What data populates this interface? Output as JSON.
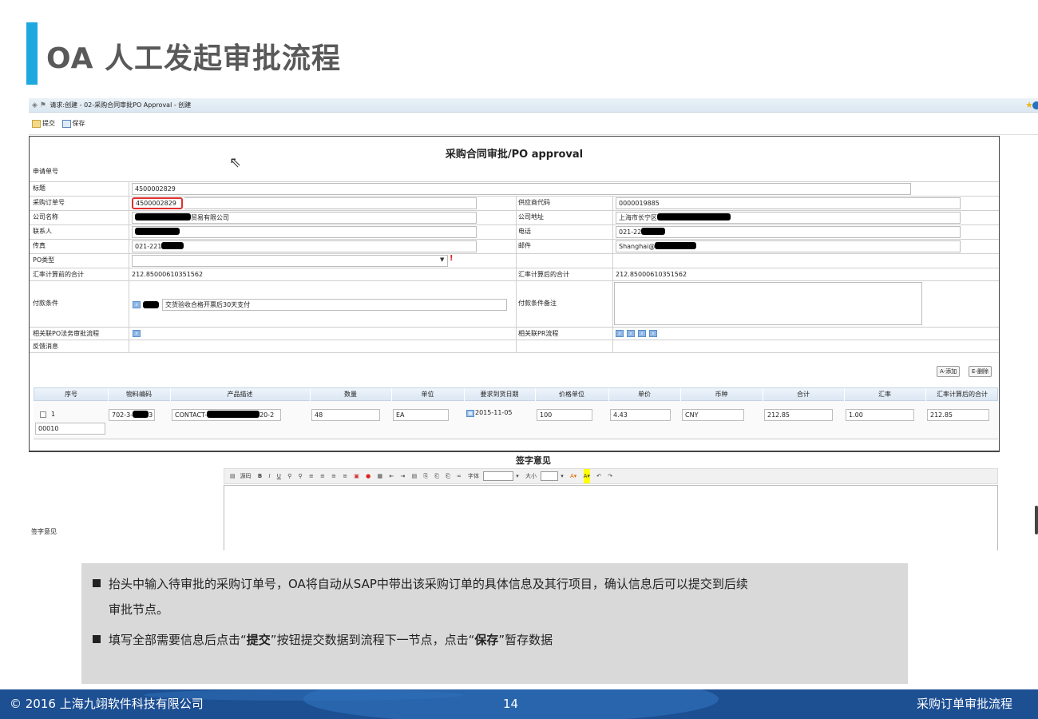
{
  "slide": {
    "title": "OA 人工发起审批流程",
    "page_number": "14",
    "copyright": "© 2016 上海九翊软件科技有限公司",
    "footer_right": "采购订单审批流程"
  },
  "window": {
    "title": "请求:创建 - 02-采购合同审批PO Approval - 创建",
    "toolbar": {
      "submit": "提交",
      "save": "保存"
    }
  },
  "form": {
    "title": "采购合同审批/PO approval",
    "labels": {
      "request_no": "申请单号",
      "subject": "标题",
      "po_no": "采购订单号",
      "company": "公司名称",
      "contact": "联系人",
      "fax": "传真",
      "po_type": "PO类型",
      "pre_total": "汇率计算前的合计",
      "payment_terms": "付款条件",
      "related_legal": "相关联PO法务审批流程",
      "feedback": "反馈消息",
      "vendor_code": "供应商代码",
      "company_addr": "公司地址",
      "phone": "电话",
      "email": "邮件",
      "post_total": "汇率计算后的合计",
      "payment_notes": "付款条件备注",
      "related_pr": "相关联PR流程"
    },
    "values": {
      "subject": "4500002829",
      "po_no": "4500002829",
      "company_suffix": "贸易有限公司",
      "fax_prefix": "021-221",
      "pre_total": "212.85000610351562",
      "payment_terms": "交货验收合格开票后30天支付",
      "vendor_code": "0000019885",
      "company_addr_prefix": "上海市长宁区",
      "phone_prefix": "021-22",
      "email_prefix": "Shanghai@",
      "post_total": "212.85000610351562"
    },
    "buttons": {
      "add": "A-添加",
      "delete": "E-删除"
    },
    "table": {
      "headers": [
        "序号",
        "物料编码",
        "产品描述",
        "数量",
        "单位",
        "要求到货日期",
        "价格单位",
        "单价",
        "币种",
        "合计",
        "汇率",
        "汇率计算后的合计"
      ],
      "row": {
        "seq": "1",
        "item_no": "00010",
        "material_prefix": "702-3-",
        "material_suffix": "3",
        "desc_prefix": "CONTACT-",
        "desc_suffix": "20-2",
        "qty": "48",
        "unit": "EA",
        "date": "2015-11-05",
        "price_unit": "100",
        "unit_price": "4.43",
        "currency": "CNY",
        "total": "212.85",
        "rate": "1.00",
        "converted_total": "212.85"
      }
    }
  },
  "signature": {
    "title": "签字意见",
    "label": "签字意见",
    "editor": {
      "source": "源码",
      "font": "字体",
      "size": "大小"
    }
  },
  "notes": {
    "line1": "抬头中输入待审批的采购订单号，OA将自动从SAP中带出该采购订单的具体信息及其行项目，确认信息后可以提交到后续",
    "line1b": "审批节点。",
    "line2_a": "填写全部需要信息后点击“",
    "line2_b": "提交",
    "line2_c": "”按钮提交数据到流程下一节点，点击“",
    "line2_d": "保存",
    "line2_e": "”暂存数据"
  }
}
